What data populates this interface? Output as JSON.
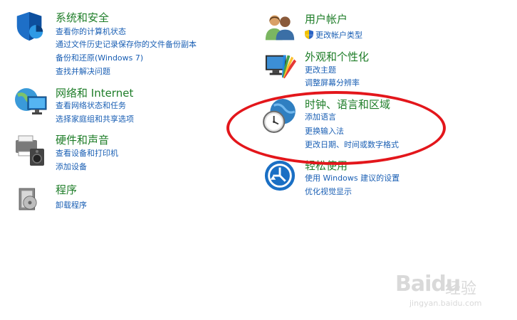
{
  "categories": {
    "system": {
      "title": "系统和安全",
      "links": [
        "查看你的计算机状态",
        "通过文件历史记录保存你的文件备份副本",
        "备份和还原(Windows 7)",
        "查找并解决问题"
      ]
    },
    "network": {
      "title": "网络和 Internet",
      "links": [
        "查看网络状态和任务",
        "选择家庭组和共享选项"
      ]
    },
    "hardware": {
      "title": "硬件和声音",
      "links": [
        "查看设备和打印机",
        "添加设备"
      ]
    },
    "programs": {
      "title": "程序",
      "links": [
        "卸载程序"
      ]
    },
    "accounts": {
      "title": "用户帐户",
      "links": [
        "更改帐户类型"
      ]
    },
    "appearance": {
      "title": "外观和个性化",
      "links": [
        "更改主题",
        "调整屏幕分辨率"
      ]
    },
    "clock": {
      "title": "时钟、语言和区域",
      "links": [
        "添加语言",
        "更换输入法",
        "更改日期、时间或数字格式"
      ]
    },
    "ease": {
      "title": "轻松使用",
      "links": [
        "使用 Windows 建议的设置",
        "优化视觉显示"
      ]
    }
  },
  "watermark": {
    "logo": "Baidu",
    "cn": "经验",
    "url": "jingyan.baidu.com"
  },
  "colors": {
    "title": "#1e7d28",
    "link": "#1a5fb4",
    "highlight": "#e3161b"
  }
}
